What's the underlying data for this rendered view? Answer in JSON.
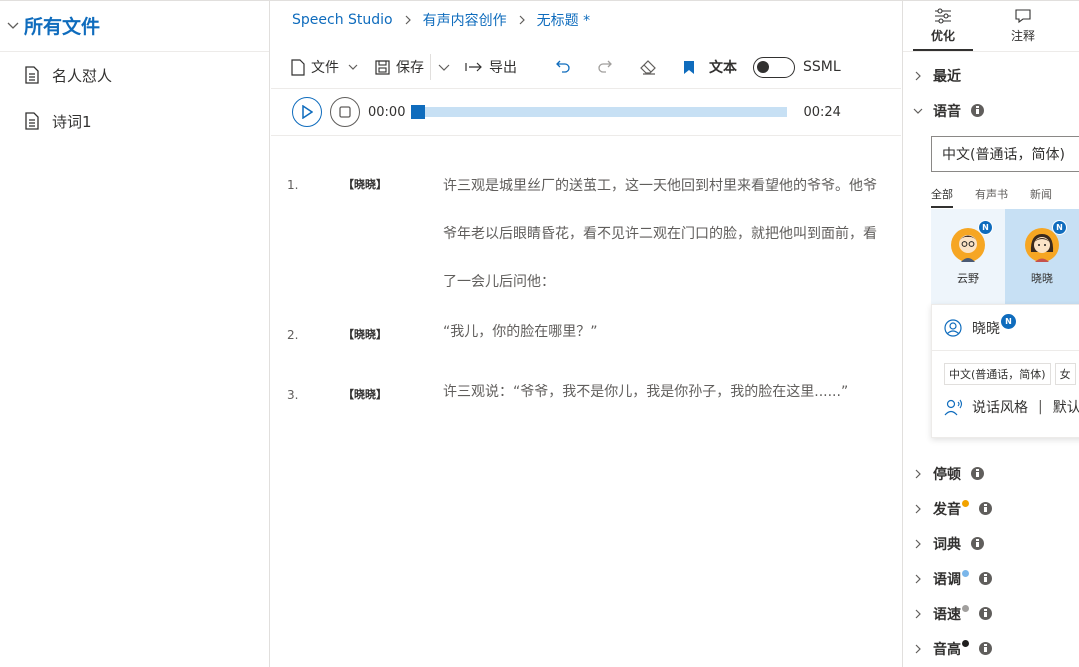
{
  "sidebar": {
    "title": "所有文件",
    "files": [
      {
        "label": "名人怼人"
      },
      {
        "label": "诗词1"
      }
    ]
  },
  "breadcrumb": {
    "items": [
      "Speech Studio",
      "有声内容创作",
      "无标题 *"
    ]
  },
  "toolbar": {
    "file_label": "文件",
    "save_label": "保存",
    "export_label": "导出",
    "text_mode_label": "文本",
    "ssml_label": "SSML"
  },
  "player": {
    "current_time": "00:00",
    "total_time": "00:24",
    "progress_fraction": 0.0
  },
  "script_lines": [
    {
      "num": "1.",
      "speaker": "【晓晓】",
      "text": "许三观是城里丝厂的送茧工，这一天他回到村里来看望他的爷爷。他爷爷年老以后眼睛昏花，看不见许二观在门口的脸，就把他叫到面前，看了一会儿后问他："
    },
    {
      "num": "2.",
      "speaker": "【晓晓】",
      "text": "“我儿，你的脸在哪里？”"
    },
    {
      "num": "3.",
      "speaker": "【晓晓】",
      "text": "许三观说：“爷爷，我不是你儿，我是你孙子，我的脸在这里......”"
    }
  ],
  "right_panel": {
    "tabs": [
      {
        "label": "优化"
      },
      {
        "label": "注释"
      }
    ],
    "recent_label": "最近",
    "voice_label": "语音",
    "language_value": "中文(普通话，简体)",
    "voice_tabs": [
      "全部",
      "有声书",
      "新闻"
    ],
    "voices": [
      {
        "name": "云野",
        "badge": "N"
      },
      {
        "name": "晓晓",
        "badge": "N"
      }
    ],
    "voice_card": {
      "name": "晓晓",
      "badge": "N",
      "tags": [
        "中文(普通话，简体)",
        "女"
      ],
      "style_label": "说话风格",
      "style_value": "默认"
    },
    "sections": [
      {
        "label": "停顿",
        "dot_color": ""
      },
      {
        "label": "发音",
        "dot_color": "#f2a300"
      },
      {
        "label": "词典",
        "dot_color": ""
      },
      {
        "label": "语调",
        "dot_color": "#7ab6ea"
      },
      {
        "label": "语速",
        "dot_color": "#a19f9d"
      },
      {
        "label": "音高",
        "dot_color": "#201f1e"
      }
    ]
  },
  "colors": {
    "accent": "#0f6cbd",
    "track": "#c7e0f4"
  }
}
